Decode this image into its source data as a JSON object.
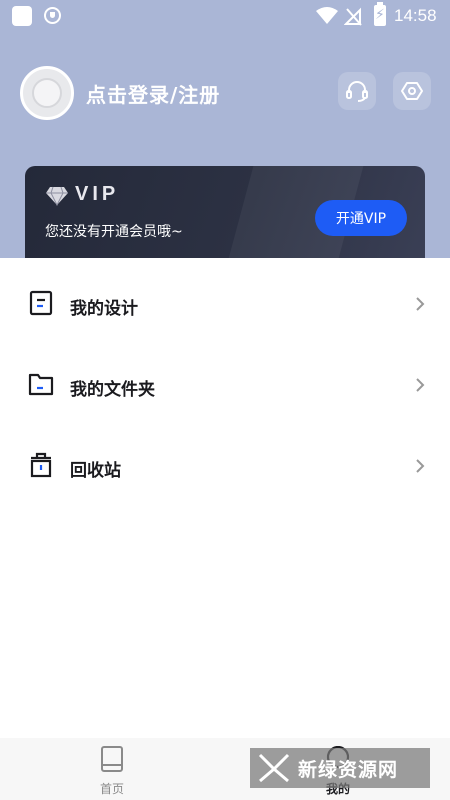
{
  "status_bar": {
    "time": "14:58"
  },
  "profile": {
    "login_prompt": "点击登录/注册"
  },
  "vip": {
    "title": "VIP",
    "subtitle": "您还没有开通会员哦~",
    "button_label": "开通VIP"
  },
  "menu": {
    "items": [
      {
        "label": "我的设计",
        "icon": "design-doc-icon"
      },
      {
        "label": "我的文件夹",
        "icon": "folder-icon"
      },
      {
        "label": "回收站",
        "icon": "trash-icon"
      }
    ]
  },
  "bottom_nav": {
    "tabs": [
      {
        "label": "首页",
        "icon": "home-book-icon",
        "active": false
      },
      {
        "label": "我的",
        "icon": "user-icon",
        "active": true
      }
    ]
  },
  "watermark": {
    "text": "新绿资源网"
  },
  "colors": {
    "header_bg": "#aab6d6",
    "vip_card_bg": "#242939",
    "vip_button": "#1e5cf5",
    "nav_bg": "#f7f7f7"
  }
}
